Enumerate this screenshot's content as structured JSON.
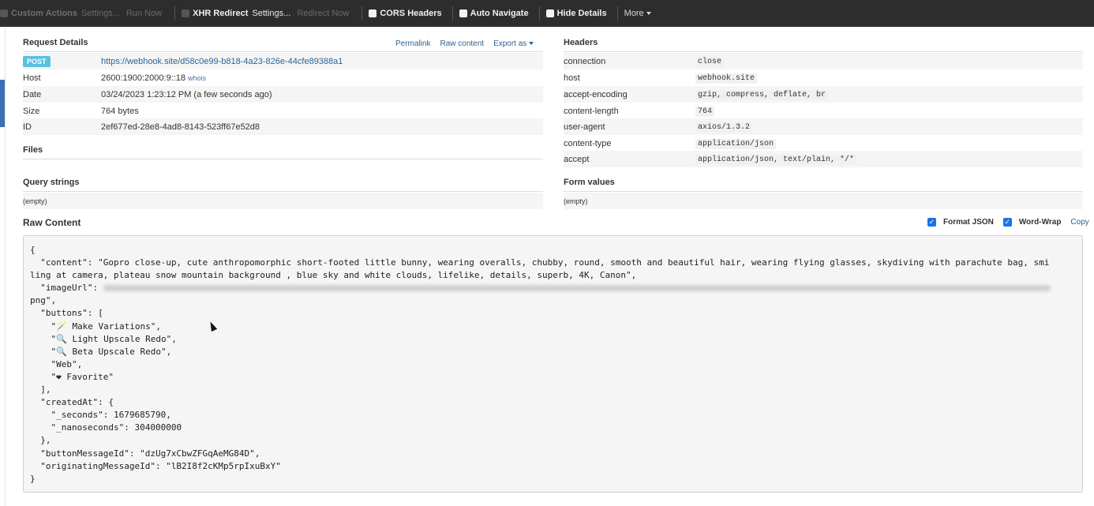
{
  "toolbar": {
    "custom_actions": "Custom Actions",
    "custom_settings": "Settings...",
    "run_now": "Run Now",
    "xhr_redirect": "XHR Redirect",
    "xhr_settings": "Settings...",
    "redirect_now": "Redirect Now",
    "cors_headers": "CORS Headers",
    "auto_navigate": "Auto Navigate",
    "hide_details": "Hide Details",
    "more": "More"
  },
  "request": {
    "title": "Request Details",
    "permalink": "Permalink",
    "raw_content": "Raw content",
    "export_as": "Export as",
    "method": "POST",
    "url": "https://webhook.site/d58c0e99-b818-4a23-826e-44cfe89388a1",
    "rows": [
      {
        "key": "Host",
        "value": "2600:1900:2000:9::18",
        "extra": "whois"
      },
      {
        "key": "Date",
        "value": "03/24/2023 1:23:12 PM (a few seconds ago)"
      },
      {
        "key": "Size",
        "value": "764 bytes"
      },
      {
        "key": "ID",
        "value": "2ef677ed-28e8-4ad8-8143-523ff67e52d8"
      }
    ]
  },
  "files": {
    "title": "Files"
  },
  "query": {
    "title": "Query strings",
    "value": "(empty)"
  },
  "headers": {
    "title": "Headers",
    "rows": [
      {
        "key": "connection",
        "value": "close"
      },
      {
        "key": "host",
        "value": "webhook.site"
      },
      {
        "key": "accept-encoding",
        "value": "gzip, compress, deflate, br"
      },
      {
        "key": "content-length",
        "value": "764"
      },
      {
        "key": "user-agent",
        "value": "axios/1.3.2"
      },
      {
        "key": "content-type",
        "value": "application/json"
      },
      {
        "key": "accept",
        "value": "application/json, text/plain, */*"
      }
    ]
  },
  "form": {
    "title": "Form values",
    "value": "(empty)"
  },
  "raw": {
    "title": "Raw Content",
    "format_json": "Format JSON",
    "word_wrap": "Word-Wrap",
    "copy": "Copy",
    "lines": {
      "l1": "{",
      "l2": "  \"content\": \"Gopro close-up, cute anthropomorphic short-footed little bunny, wearing overalls, chubby, round, smooth and beautiful hair, wearing flying glasses, skydiving with parachute bag, smi",
      "l3": "ling at camera, plateau snow mountain background , blue sky and white clouds, lifelike, details, superb, 4K, Canon\",",
      "l4": "  \"imageUrl\": ",
      "l5": "png\",",
      "l6": "  \"buttons\": [",
      "l7": "    \"🪄 Make Variations\",",
      "l8": "    \"🔍 Light Upscale Redo\",",
      "l9": "    \"🔍 Beta Upscale Redo\",",
      "l10": "    \"Web\",",
      "l11": "    \"❤ Favorite\"",
      "l12": "  ],",
      "l13": "  \"createdAt\": {",
      "l14": "    \"_seconds\": 1679685790,",
      "l15": "    \"_nanoseconds\": 304000000",
      "l16": "  },",
      "l17": "  \"buttonMessageId\": \"dzUg7xCbwZFGqAeMG84D\",",
      "l18": "  \"originatingMessageId\": \"lB2I8f2cKMp5rpIxuBxY\"",
      "l19": "}"
    }
  }
}
